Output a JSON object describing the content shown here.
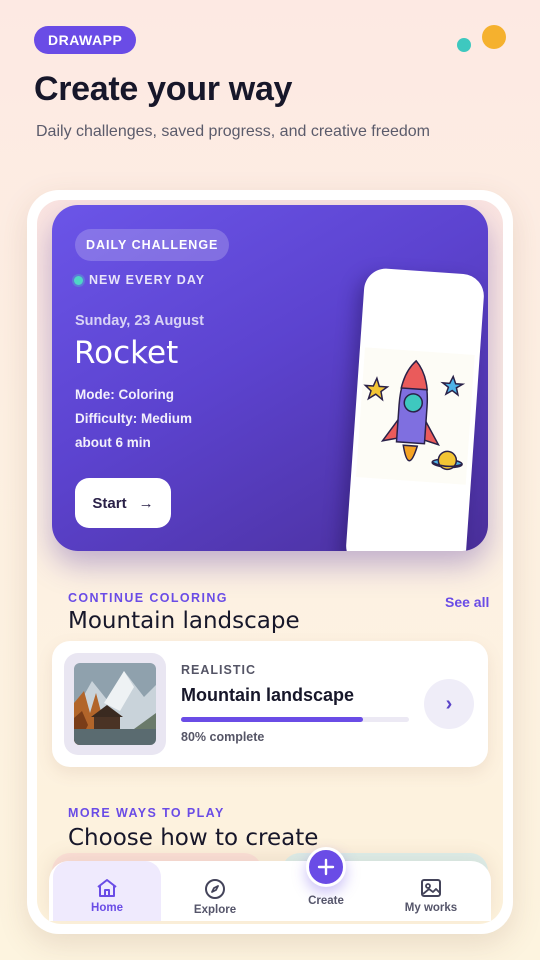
{
  "header": {
    "brand": "DRAWAPP",
    "title": "Create your way",
    "subtitle": "Daily challenges, saved progress, and creative freedom"
  },
  "hero": {
    "badge": "DAILY CHALLENGE",
    "live_label": "NEW EVERY DAY",
    "date": "Sunday, 23 August",
    "title": "Rocket",
    "mode": "Mode: Coloring",
    "difficulty": "Difficulty: Medium",
    "duration": "about 6 min",
    "start_label": "Start",
    "start_arrow": "→"
  },
  "continue_section": {
    "eyebrow": "CONTINUE COLORING",
    "title": "Mountain landscape",
    "see_all": "See all",
    "card": {
      "category": "REALISTIC",
      "name": "Mountain landscape",
      "progress": 0.8,
      "progress_label": "80% complete",
      "go_icon": "chevron-right-icon",
      "go_glyph": "›"
    }
  },
  "more_section": {
    "eyebrow": "MORE WAYS TO PLAY",
    "title": "Choose how to create"
  },
  "nav": {
    "items": [
      {
        "label": "Home",
        "icon": "home-icon",
        "active": true
      },
      {
        "label": "Explore",
        "icon": "compass-icon",
        "active": false
      },
      {
        "label": "Create",
        "icon": "plus-icon",
        "active": false
      },
      {
        "label": "My works",
        "icon": "image-icon",
        "active": false
      }
    ]
  },
  "colors": {
    "accent": "#6a4ce6",
    "teal": "#3ec8bf",
    "orange": "#f5b12e"
  }
}
